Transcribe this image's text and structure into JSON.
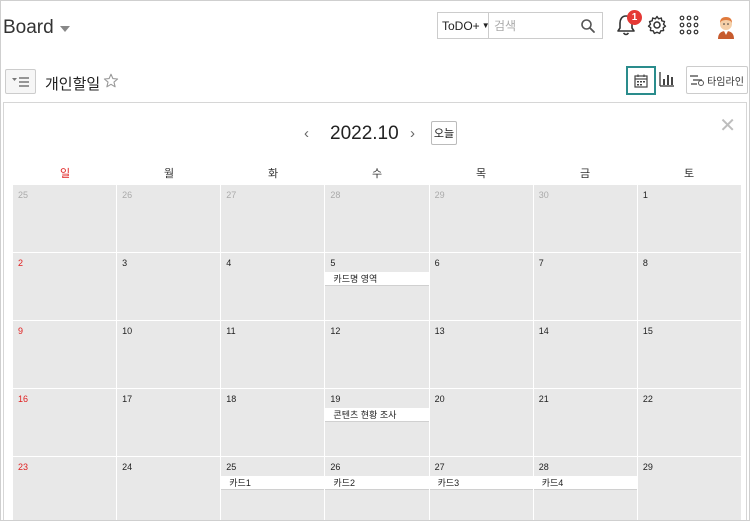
{
  "header": {
    "board_title": "Board",
    "search": {
      "scope": "ToDO+",
      "placeholder": "검색"
    },
    "notification_count": "1"
  },
  "toolbar": {
    "page_title": "개인할일",
    "timeline_label": "타임라인"
  },
  "calendar": {
    "month_title": "2022.10",
    "today_label": "오늘",
    "weekdays": [
      "일",
      "월",
      "화",
      "수",
      "목",
      "금",
      "토"
    ],
    "weeks": [
      [
        {
          "day": "25",
          "other": true
        },
        {
          "day": "26",
          "other": true
        },
        {
          "day": "27",
          "other": true
        },
        {
          "day": "28",
          "other": true
        },
        {
          "day": "29",
          "other": true
        },
        {
          "day": "30",
          "other": true
        },
        {
          "day": "1"
        }
      ],
      [
        {
          "day": "2"
        },
        {
          "day": "3"
        },
        {
          "day": "4"
        },
        {
          "day": "5",
          "event": "카드명 영역"
        },
        {
          "day": "6"
        },
        {
          "day": "7"
        },
        {
          "day": "8"
        }
      ],
      [
        {
          "day": "9"
        },
        {
          "day": "10"
        },
        {
          "day": "11"
        },
        {
          "day": "12"
        },
        {
          "day": "13"
        },
        {
          "day": "14"
        },
        {
          "day": "15"
        }
      ],
      [
        {
          "day": "16"
        },
        {
          "day": "17"
        },
        {
          "day": "18"
        },
        {
          "day": "19",
          "event": "콘텐츠 현황 조사"
        },
        {
          "day": "20"
        },
        {
          "day": "21"
        },
        {
          "day": "22"
        }
      ],
      [
        {
          "day": "23"
        },
        {
          "day": "24"
        },
        {
          "day": "25",
          "event": "카드1"
        },
        {
          "day": "26",
          "event": "카드2"
        },
        {
          "day": "27",
          "event": "카드3"
        },
        {
          "day": "28",
          "event": "카드4"
        },
        {
          "day": "29"
        }
      ]
    ]
  },
  "colors": {
    "sunday": "#e02020",
    "active_view_border": "#2a8c8c",
    "badge": "#e53935",
    "cell_bg": "#e8e8e8"
  }
}
